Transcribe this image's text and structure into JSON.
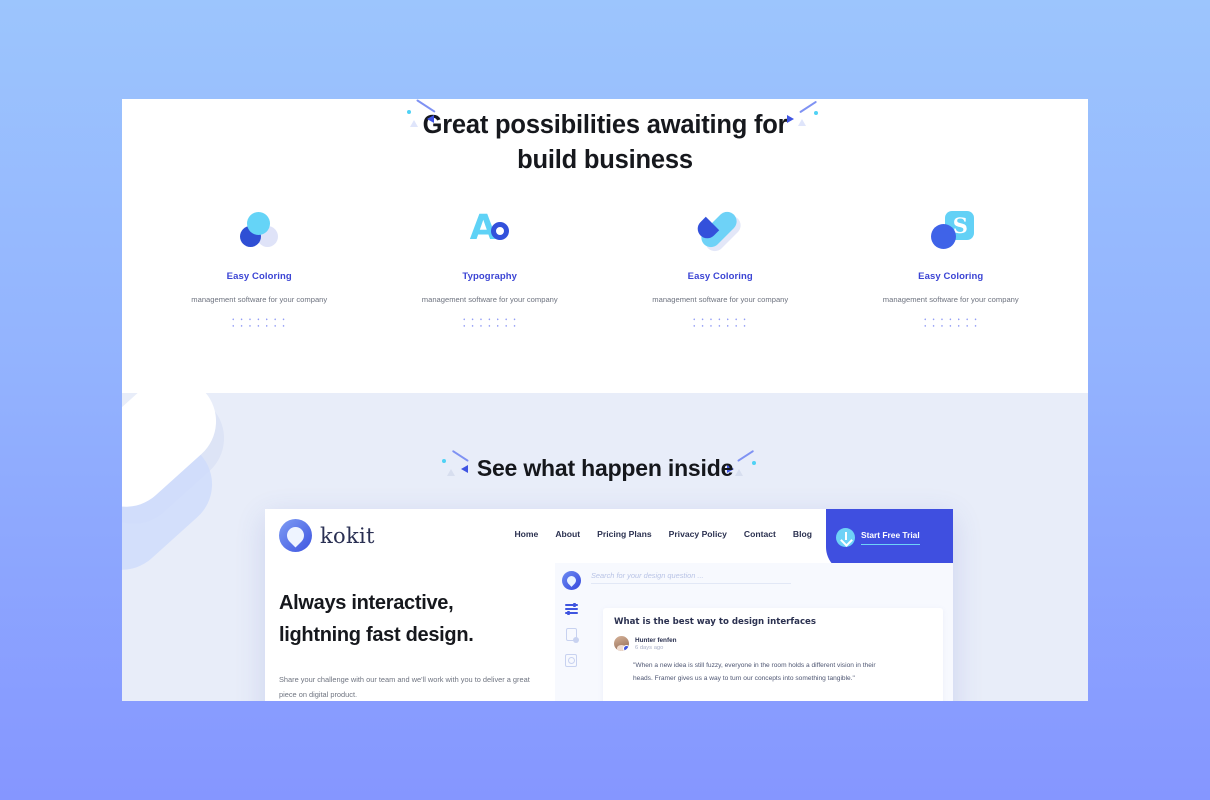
{
  "theme": {
    "bg_gradient_from": "#9cc5fd",
    "bg_gradient_to": "#8596ff",
    "accent_blue": "#3f4fe0",
    "accent_cyan": "#6ed2f7",
    "title_color": "#3b44d4",
    "section_white": "#ffffff",
    "section_lavender": "#e8edf9"
  },
  "features_section": {
    "heading_line1": "Great possibilities awaiting for",
    "heading_line2": "build business",
    "cards": [
      {
        "icon": "three-circles-icon",
        "title": "Easy Coloring",
        "description": "management software for your company"
      },
      {
        "icon": "letter-a-o-icon",
        "title": "Typography",
        "description": "management software for your company"
      },
      {
        "icon": "pill-capsule-icon",
        "title": "Easy Coloring",
        "description": "management software for your company"
      },
      {
        "icon": "letter-s-square-icon",
        "title": "Easy Coloring",
        "description": "management software for your company"
      }
    ]
  },
  "inside_section": {
    "heading": "See what happen inside",
    "browser_mock": {
      "logo_text": "kokit",
      "nav_items": [
        "Home",
        "About",
        "Pricing Plans",
        "Privacy Policy",
        "Contact",
        "Blog"
      ],
      "cta_label": "Start Free Trial",
      "hero_line1": "Always interactive,",
      "hero_line2": "lightning fast design.",
      "hero_paragraph": "Share your challenge with our team and we'll work with you to deliver a great piece on digital product.",
      "app": {
        "search_placeholder": "Search for your design question ...",
        "rail_icons": [
          "app-logo-icon",
          "sliders-icon",
          "document-icon",
          "image-icon"
        ],
        "post_title": "What is the best way to design interfaces",
        "author_name": "Hunter fenfen",
        "author_time": "6 days ago",
        "post_quote": "\"When a new idea is still fuzzy, everyone in the room holds a different  vision in their heads. Framer gives us a way to turn our concepts into something tangible.\""
      }
    }
  }
}
